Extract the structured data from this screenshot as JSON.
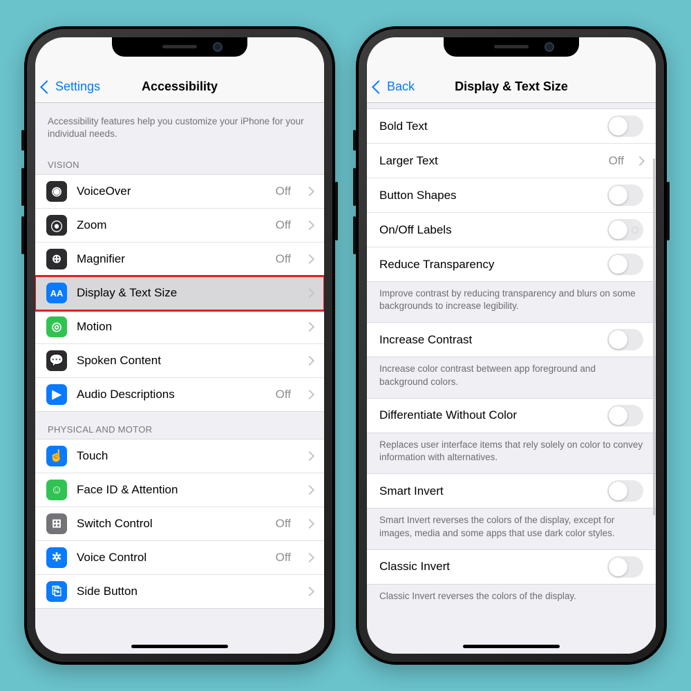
{
  "phone_left": {
    "nav": {
      "back_label": "Settings",
      "title": "Accessibility"
    },
    "intro": "Accessibility features help you customize your iPhone for your individual needs.",
    "sections": [
      {
        "header": "VISION",
        "rows": [
          {
            "icon": "voiceover-icon",
            "icon_bg": "ic-dark",
            "label": "VoiceOver",
            "value": "Off",
            "disclosure": true,
            "highlight": false
          },
          {
            "icon": "zoom-icon",
            "icon_bg": "ic-dark",
            "label": "Zoom",
            "value": "Off",
            "disclosure": true,
            "highlight": false
          },
          {
            "icon": "magnifier-icon",
            "icon_bg": "ic-dark",
            "label": "Magnifier",
            "value": "Off",
            "disclosure": true,
            "highlight": false
          },
          {
            "icon": "display-text-icon",
            "icon_bg": "ic-blue",
            "label": "Display & Text Size",
            "value": "",
            "disclosure": true,
            "highlight": true
          },
          {
            "icon": "motion-icon",
            "icon_bg": "ic-green",
            "label": "Motion",
            "value": "",
            "disclosure": true,
            "highlight": false
          },
          {
            "icon": "spoken-icon",
            "icon_bg": "ic-dark",
            "label": "Spoken Content",
            "value": "",
            "disclosure": true,
            "highlight": false
          },
          {
            "icon": "audio-desc-icon",
            "icon_bg": "ic-blue",
            "label": "Audio Descriptions",
            "value": "Off",
            "disclosure": true,
            "highlight": false
          }
        ]
      },
      {
        "header": "PHYSICAL AND MOTOR",
        "rows": [
          {
            "icon": "touch-icon",
            "icon_bg": "ic-blue",
            "label": "Touch",
            "value": "",
            "disclosure": true,
            "highlight": false
          },
          {
            "icon": "faceid-icon",
            "icon_bg": "ic-green",
            "label": "Face ID & Attention",
            "value": "",
            "disclosure": true,
            "highlight": false
          },
          {
            "icon": "switch-icon",
            "icon_bg": "ic-grey",
            "label": "Switch Control",
            "value": "Off",
            "disclosure": true,
            "highlight": false
          },
          {
            "icon": "voice-ctrl-icon",
            "icon_bg": "ic-blue",
            "label": "Voice Control",
            "value": "Off",
            "disclosure": true,
            "highlight": false
          },
          {
            "icon": "side-btn-icon",
            "icon_bg": "ic-blue",
            "label": "Side Button",
            "value": "",
            "disclosure": true,
            "highlight": false
          }
        ]
      }
    ]
  },
  "phone_right": {
    "nav": {
      "back_label": "Back",
      "title": "Display & Text Size"
    },
    "groups": [
      {
        "rows": [
          {
            "label": "Bold Text",
            "control": "toggle",
            "on": false
          },
          {
            "label": "Larger Text",
            "control": "value",
            "value": "Off",
            "disclosure": true
          },
          {
            "label": "Button Shapes",
            "control": "toggle",
            "on": false
          },
          {
            "label": "On/Off Labels",
            "control": "toggle",
            "on": false,
            "ring": true
          },
          {
            "label": "Reduce Transparency",
            "control": "toggle",
            "on": false
          }
        ],
        "footer": "Improve contrast by reducing transparency and blurs on some backgrounds to increase legibility."
      },
      {
        "rows": [
          {
            "label": "Increase Contrast",
            "control": "toggle",
            "on": false
          }
        ],
        "footer": "Increase color contrast between app foreground and background colors."
      },
      {
        "rows": [
          {
            "label": "Differentiate Without Color",
            "control": "toggle",
            "on": false
          }
        ],
        "footer": "Replaces user interface items that rely solely on color to convey information with alternatives."
      },
      {
        "rows": [
          {
            "label": "Smart Invert",
            "control": "toggle",
            "on": false
          }
        ],
        "footer": "Smart Invert reverses the colors of the display, except for images, media and some apps that use dark color styles."
      },
      {
        "rows": [
          {
            "label": "Classic Invert",
            "control": "toggle",
            "on": false
          }
        ],
        "footer": "Classic Invert reverses the colors of the display."
      }
    ]
  },
  "glyphs": {
    "voiceover-icon": "◉",
    "zoom-icon": "⦿",
    "magnifier-icon": "⊕",
    "display-text-icon": "AA",
    "motion-icon": "◎",
    "spoken-icon": "💬",
    "audio-desc-icon": "▶",
    "touch-icon": "☝",
    "faceid-icon": "☺",
    "switch-icon": "⊞",
    "voice-ctrl-icon": "✲",
    "side-btn-icon": "⎘"
  }
}
